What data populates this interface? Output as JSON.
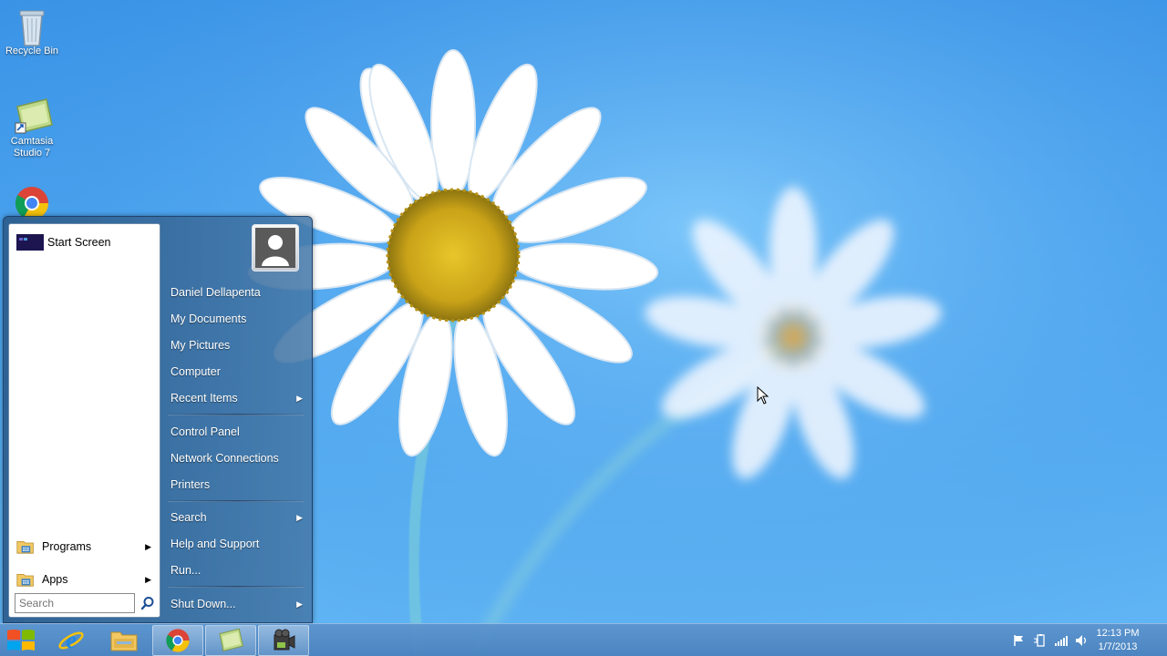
{
  "desktop": {
    "icons": [
      {
        "label": "Recycle Bin",
        "icon": "recycle-bin-icon"
      },
      {
        "label": "Camtasia\nStudio 7",
        "line1": "Camtasia",
        "line2": "Studio 7",
        "icon": "camtasia-icon"
      },
      {
        "label": "",
        "icon": "chrome-icon"
      }
    ]
  },
  "start_menu": {
    "left": {
      "pinned": [
        {
          "label": "Start Screen",
          "icon": "start-screen-icon"
        }
      ],
      "programs_label": "Programs",
      "apps_label": "Apps",
      "search_placeholder": "Search"
    },
    "right": {
      "user_name": "Daniel Dellapenta",
      "items_group1": [
        "My Documents",
        "My Pictures",
        "Computer",
        "Recent Items"
      ],
      "items_group2": [
        "Control Panel",
        "Network Connections",
        "Printers"
      ],
      "items_group3": [
        "Search",
        "Help and Support",
        "Run..."
      ],
      "shutdown_label": "Shut Down..."
    }
  },
  "taskbar": {
    "apps": [
      "start-orb-icon",
      "internet-explorer-icon",
      "file-explorer-icon",
      "chrome-icon",
      "camtasia-icon",
      "camtasia-recorder-icon"
    ],
    "active_app": "chrome-icon",
    "clock": {
      "time": "12:13 PM",
      "date": "1/7/2013"
    }
  },
  "colors": {
    "wallpaper_sky": "#4aa3ee",
    "start_menu_bg": "#3a6c9c",
    "taskbar_bg": "#5c94ce"
  }
}
